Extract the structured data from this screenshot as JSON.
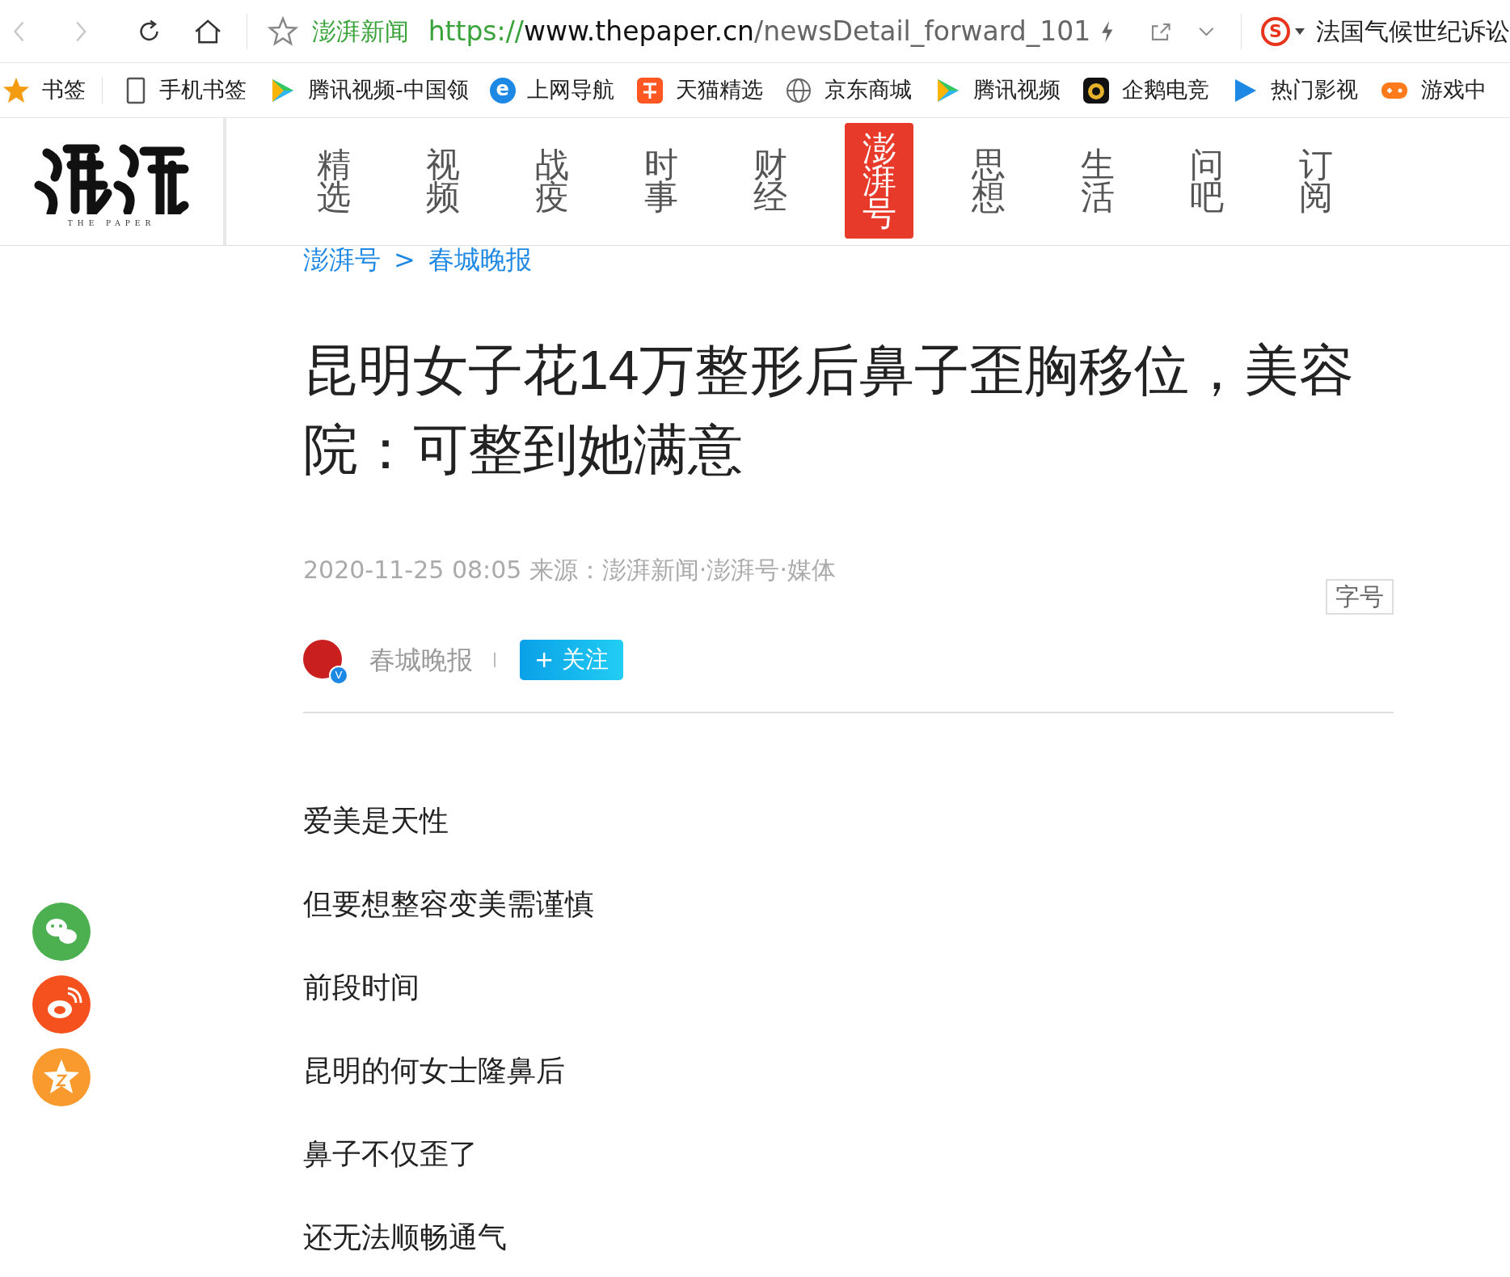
{
  "browser": {
    "site_name": "澎湃新闻",
    "url_scheme": "https://",
    "url_host": "www.thepaper.cn",
    "url_path": "/newsDetail_forward_101",
    "search_engine_mark": "S",
    "search_text": "法国气候世纪诉讼"
  },
  "logo_subtitle": "THE PAPER",
  "bookmarks": [
    {
      "label": "书签",
      "kind": "star"
    },
    {
      "label": "手机书签",
      "kind": "phone"
    },
    {
      "label": "腾讯视频-中国领",
      "kind": "video"
    },
    {
      "label": "上网导航",
      "kind": "ie",
      "icon_text": "e"
    },
    {
      "label": "天猫精选",
      "kind": "tmall"
    },
    {
      "label": "京东商城",
      "kind": "globe"
    },
    {
      "label": "腾讯视频",
      "kind": "video"
    },
    {
      "label": "企鹅电竞",
      "kind": "esports"
    },
    {
      "label": "热门影视",
      "kind": "play"
    },
    {
      "label": "游戏中",
      "kind": "game"
    }
  ],
  "nav": [
    {
      "label": "精选",
      "selected": false
    },
    {
      "label": "视频",
      "selected": false
    },
    {
      "label": "战疫",
      "selected": false
    },
    {
      "label": "时事",
      "selected": false
    },
    {
      "label": "财经",
      "selected": false
    },
    {
      "label": "澎湃号",
      "selected": true
    },
    {
      "label": "思想",
      "selected": false
    },
    {
      "label": "生活",
      "selected": false
    },
    {
      "label": "问吧",
      "selected": false
    },
    {
      "label": "订阅",
      "selected": false
    }
  ],
  "breadcrumb": [
    "澎湃号",
    "春城晚报"
  ],
  "breadcrumb_separator": ">",
  "article": {
    "title": "昆明女子花14万整形后鼻子歪胸移位，美容院：可整到她满意",
    "meta": "2020-11-25 08:05 来源：澎湃新闻·澎湃号·媒体",
    "font_size_button": "字号",
    "author": "春城晚报",
    "verified_mark": "V",
    "follow_button": "+ 关注",
    "paragraphs": [
      "爱美是天性",
      "但要想整容变美需谨慎",
      "前段时间",
      "昆明的何女士隆鼻后",
      "鼻子不仅歪了",
      "还无法顺畅通气"
    ]
  },
  "share": [
    {
      "kind": "wechat",
      "color": "#4caf50"
    },
    {
      "kind": "weibo",
      "color": "#f4511e"
    },
    {
      "kind": "qzone",
      "color": "#f99a2e"
    }
  ]
}
